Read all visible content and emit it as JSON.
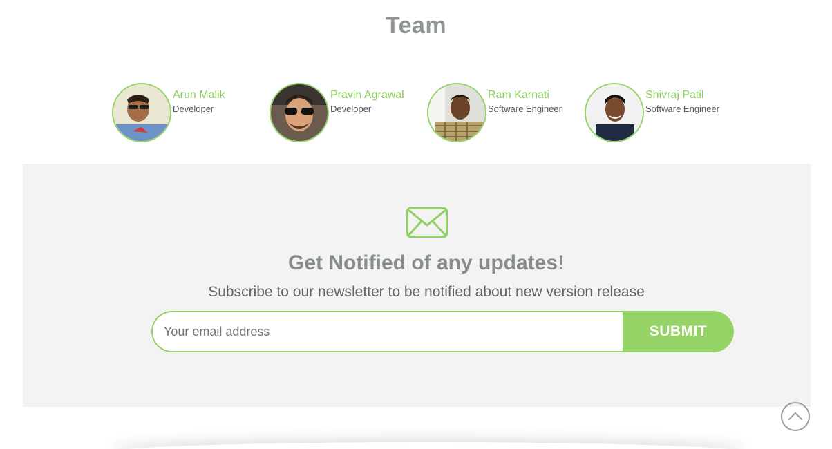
{
  "team": {
    "title": "Team",
    "members": [
      {
        "name": "Arun Malik",
        "role": "Developer"
      },
      {
        "name": "Pravin Agrawal",
        "role": "Developer"
      },
      {
        "name": "Ram Karnati",
        "role": "Software Engineer"
      },
      {
        "name": "Shivraj Patil",
        "role": "Software Engineer"
      }
    ]
  },
  "newsletter": {
    "icon": "envelope-icon",
    "title": "Get Notified of any updates!",
    "subtitle": "Subscribe to our newsletter to be notified about new version release",
    "email_placeholder": "Your email address",
    "submit_label": "SUBMIT"
  },
  "scroll_top": {
    "icon": "chevron-up-icon"
  },
  "colors": {
    "accent": "#96d366",
    "panel_bg": "#f2f3f2",
    "title_text": "#8f9496"
  }
}
